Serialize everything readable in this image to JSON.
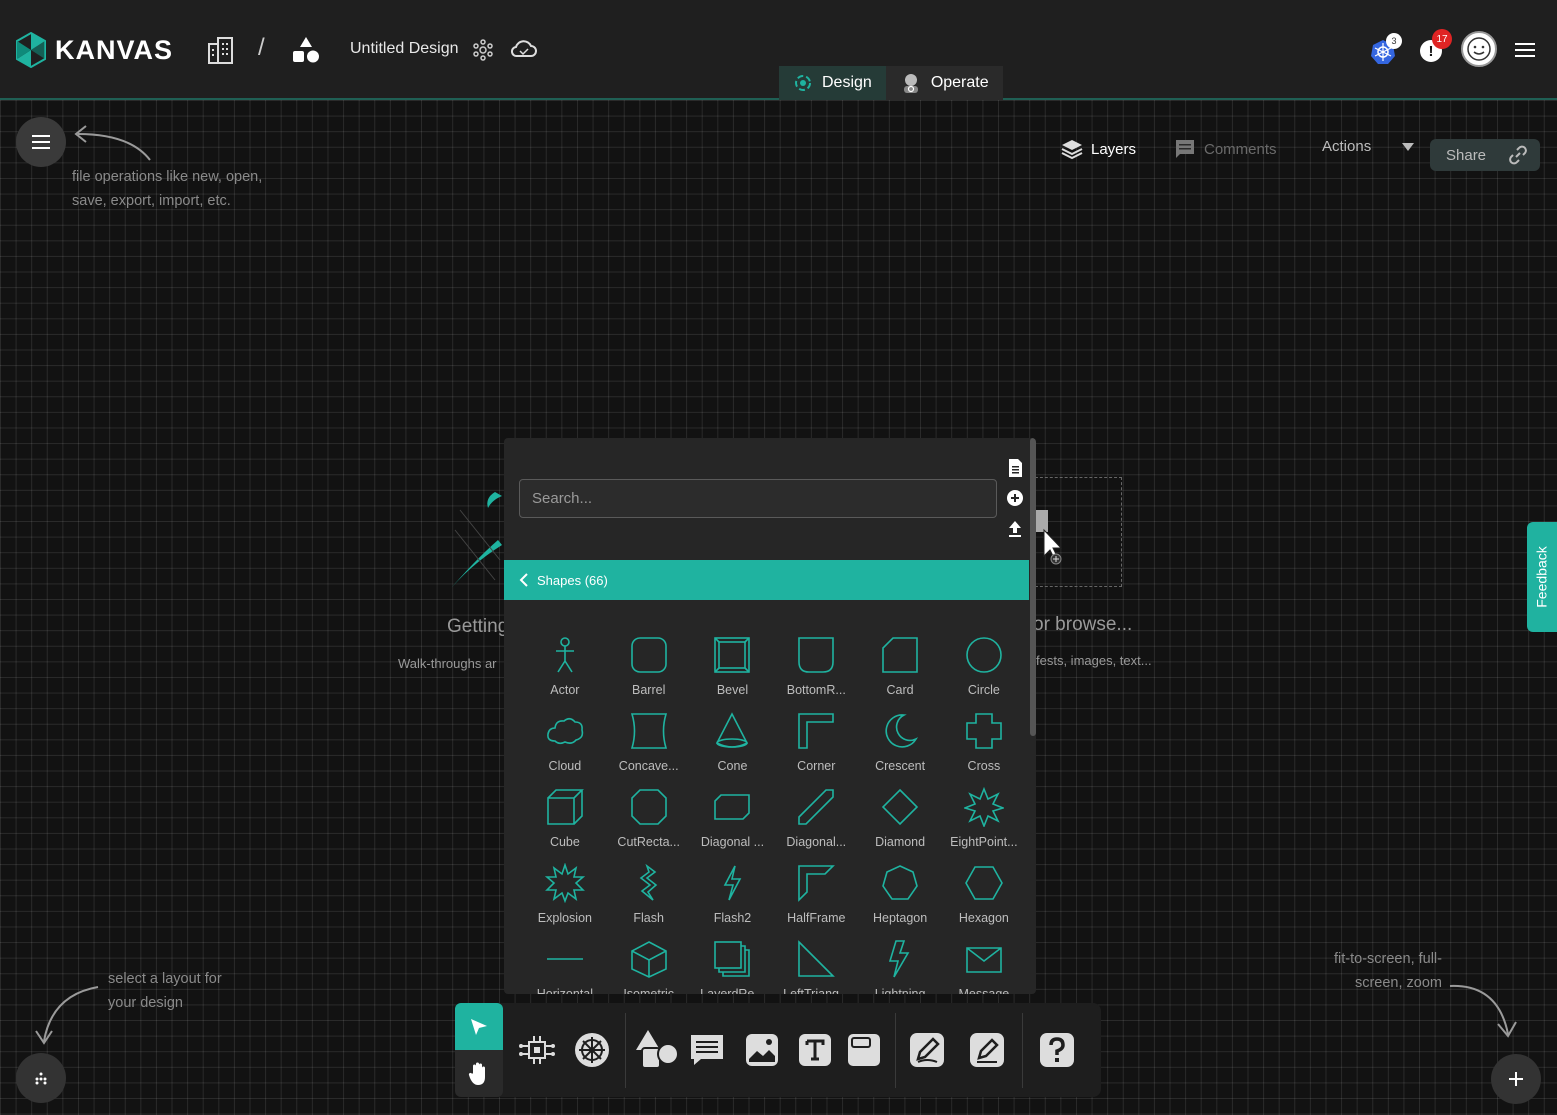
{
  "app": {
    "name": "KANVAS"
  },
  "header": {
    "design_title": "Untitled Design",
    "tabs": [
      {
        "label": "Design"
      },
      {
        "label": "Operate"
      }
    ],
    "k8s_badge": "3",
    "notification_badge": "17"
  },
  "hints": {
    "file_ops": "file operations like new, open, save, export, import, etc.",
    "layout": "select a layout for your design",
    "zoom": "fit-to-screen, full-screen, zoom"
  },
  "top_actions": {
    "layers": "Layers",
    "comments": "Comments",
    "actions": "Actions",
    "share": "Share"
  },
  "feedback": "Feedback",
  "background": {
    "getting": "Getting",
    "walkthrough": "Walk-throughs ar",
    "browse": "or browse...",
    "manifests": "fests, images, text..."
  },
  "panel": {
    "search_placeholder": "Search...",
    "category": "Shapes (66)",
    "shapes": [
      {
        "label": "Actor",
        "icon": "actor"
      },
      {
        "label": "Barrel",
        "icon": "barrel"
      },
      {
        "label": "Bevel",
        "icon": "bevel"
      },
      {
        "label": "BottomR...",
        "icon": "bottom-round"
      },
      {
        "label": "Card",
        "icon": "card"
      },
      {
        "label": "Circle",
        "icon": "circle"
      },
      {
        "label": "Cloud",
        "icon": "cloud"
      },
      {
        "label": "Concave...",
        "icon": "concave"
      },
      {
        "label": "Cone",
        "icon": "cone"
      },
      {
        "label": "Corner",
        "icon": "corner"
      },
      {
        "label": "Crescent",
        "icon": "crescent"
      },
      {
        "label": "Cross",
        "icon": "cross"
      },
      {
        "label": "Cube",
        "icon": "cube"
      },
      {
        "label": "CutRecta...",
        "icon": "cut-rect"
      },
      {
        "label": "Diagonal ...",
        "icon": "diag-rect"
      },
      {
        "label": "Diagonal...",
        "icon": "diag-stripe"
      },
      {
        "label": "Diamond",
        "icon": "diamond"
      },
      {
        "label": "EightPoint...",
        "icon": "eight-point"
      },
      {
        "label": "Explosion",
        "icon": "explosion"
      },
      {
        "label": "Flash",
        "icon": "flash"
      },
      {
        "label": "Flash2",
        "icon": "flash2"
      },
      {
        "label": "HalfFrame",
        "icon": "halfframe"
      },
      {
        "label": "Heptagon",
        "icon": "heptagon"
      },
      {
        "label": "Hexagon",
        "icon": "hexagon"
      },
      {
        "label": "Horizontal",
        "icon": "horizontal"
      },
      {
        "label": "Isometric",
        "icon": "isometric"
      },
      {
        "label": "LayerdRe...",
        "icon": "layered"
      },
      {
        "label": "LeftTriang...",
        "icon": "left-triangle"
      },
      {
        "label": "Lightning",
        "icon": "lightning"
      },
      {
        "label": "Message",
        "icon": "message"
      }
    ]
  },
  "colors": {
    "accent": "#1fb3a0",
    "canvas": "#121212",
    "panel": "#262626",
    "badge_red": "#e02424"
  }
}
